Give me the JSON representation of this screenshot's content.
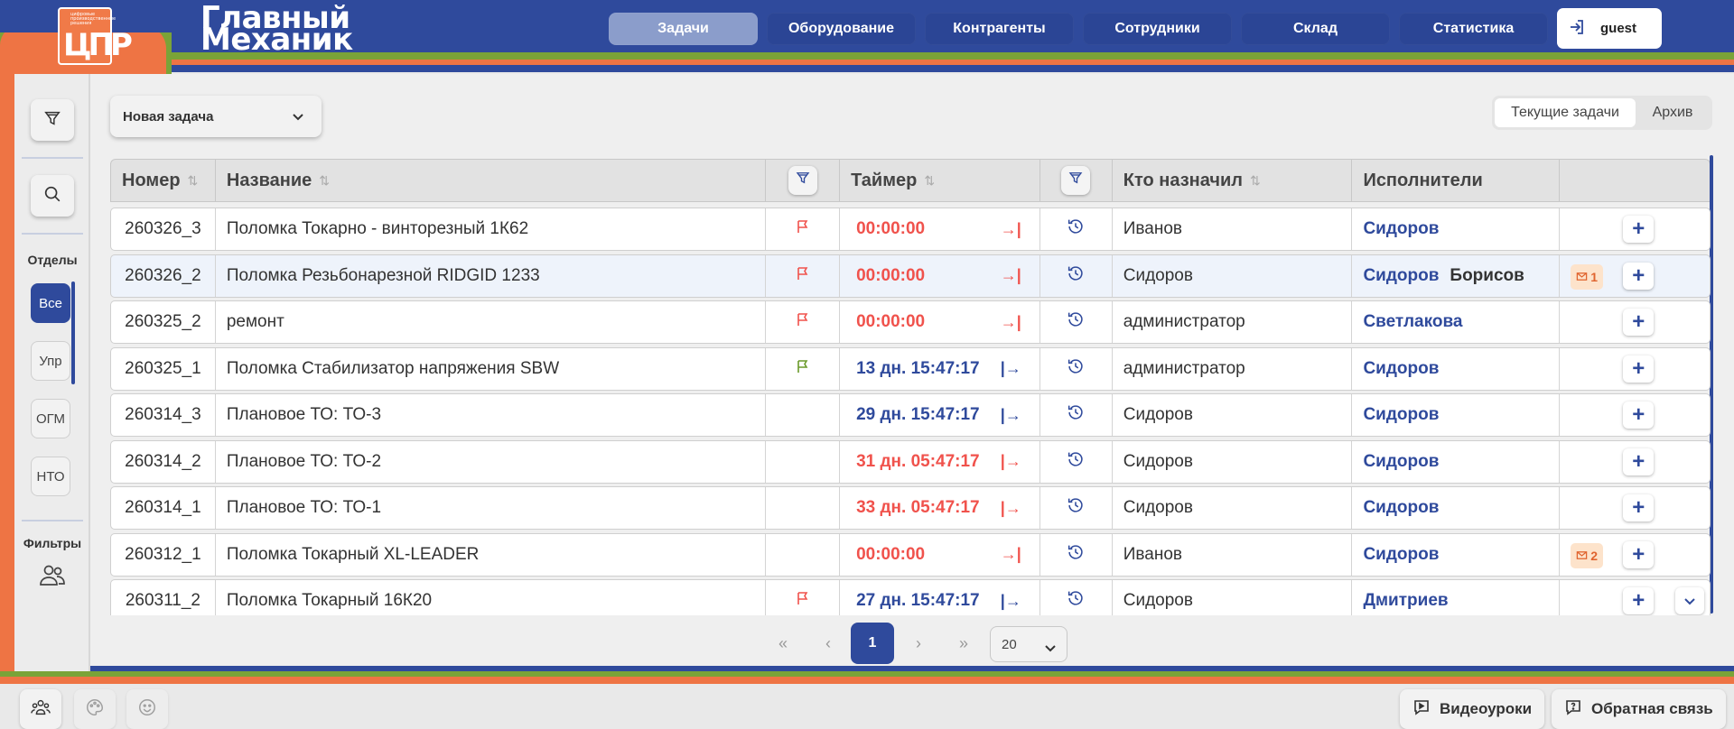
{
  "brand": {
    "logo_small_text": "цифровые производственные решения",
    "logo_mark": "ЦПР",
    "title_line1": "Главный",
    "title_line2": "Механик"
  },
  "nav": {
    "items": [
      {
        "label": "Задачи",
        "active": true
      },
      {
        "label": "Оборудование",
        "active": false
      },
      {
        "label": "Контрагенты",
        "active": false
      },
      {
        "label": "Сотрудники",
        "active": false
      },
      {
        "label": "Склад",
        "active": false
      },
      {
        "label": "Статистика",
        "active": false
      }
    ],
    "user": "guest"
  },
  "sidebar": {
    "departments_label": "Отделы",
    "departments": [
      "Все",
      "Упр",
      "ОГМ",
      "НТО"
    ],
    "active_department": "Все",
    "filters_label": "Фильтры"
  },
  "toolbar": {
    "new_task_label": "Новая задача",
    "tab_current": "Текущие задачи",
    "tab_archive": "Архив"
  },
  "table": {
    "columns": {
      "number": "Номер",
      "name": "Название",
      "timer": "Таймер",
      "assigned_by": "Кто назначил",
      "executors": "Исполнители"
    },
    "rows": [
      {
        "number": "260326_3",
        "name": "Поломка Токарно - винторезный 1К62",
        "flag": "red",
        "timer": "00:00:00",
        "timer_color": "red",
        "timer_icon": "→|",
        "assigned_by": "Иванов",
        "executors": [
          "Сидоров"
        ],
        "messages": ""
      },
      {
        "number": "260326_2",
        "name": "Поломка Резьбонарезной RIDGID 1233",
        "flag": "red",
        "timer": "00:00:00",
        "timer_color": "red",
        "timer_icon": "→|",
        "assigned_by": "Сидоров",
        "executors": [
          "Сидоров",
          "Борисов"
        ],
        "messages": "1"
      },
      {
        "number": "260325_2",
        "name": "ремонт",
        "flag": "red",
        "timer": "00:00:00",
        "timer_color": "red",
        "timer_icon": "→|",
        "assigned_by": "администратор",
        "executors": [
          "Светлакова"
        ],
        "messages": ""
      },
      {
        "number": "260325_1",
        "name": "Поломка Стабилизатор напряжения SBW",
        "flag": "green",
        "timer": "13 дн. 15:47:17",
        "timer_color": "blue",
        "timer_icon": "|→",
        "assigned_by": "администратор",
        "executors": [
          "Сидоров"
        ],
        "messages": ""
      },
      {
        "number": "260314_3",
        "name": "Плановое ТО: ТО-3",
        "flag": "",
        "timer": "29 дн. 15:47:17",
        "timer_color": "blue",
        "timer_icon": "|→",
        "assigned_by": "Сидоров",
        "executors": [
          "Сидоров"
        ],
        "messages": ""
      },
      {
        "number": "260314_2",
        "name": "Плановое ТО: ТО-2",
        "flag": "",
        "timer": "31 дн. 05:47:17",
        "timer_color": "red",
        "timer_icon": "|→",
        "assigned_by": "Сидоров",
        "executors": [
          "Сидоров"
        ],
        "messages": ""
      },
      {
        "number": "260314_1",
        "name": "Плановое ТО: ТО-1",
        "flag": "",
        "timer": "33 дн. 05:47:17",
        "timer_color": "red",
        "timer_icon": "|→",
        "assigned_by": "Сидоров",
        "executors": [
          "Сидоров"
        ],
        "messages": ""
      },
      {
        "number": "260312_1",
        "name": "Поломка Токарный XL-LEADER",
        "flag": "",
        "timer": "00:00:00",
        "timer_color": "red",
        "timer_icon": "→|",
        "assigned_by": "Иванов",
        "executors": [
          "Сидоров"
        ],
        "messages": "2"
      },
      {
        "number": "260311_2",
        "name": "Поломка Токарный 16К20",
        "flag": "red",
        "timer": "27 дн. 15:47:17",
        "timer_color": "blue",
        "timer_icon": "|→",
        "assigned_by": "Сидоров",
        "executors": [
          "Дмитриев"
        ],
        "messages": ""
      }
    ]
  },
  "pagination": {
    "first": "«",
    "prev": "‹",
    "current": "1",
    "next": "›",
    "last": "»",
    "page_size": "20"
  },
  "footer": {
    "video_label": "Видеоуроки",
    "feedback_label": "Обратная связь"
  },
  "colors": {
    "primary": "#2f4a9c",
    "green": "#7aa338",
    "orange": "#ee7444",
    "red_text": "#f0524c",
    "flag_green": "#6a9a2a"
  }
}
